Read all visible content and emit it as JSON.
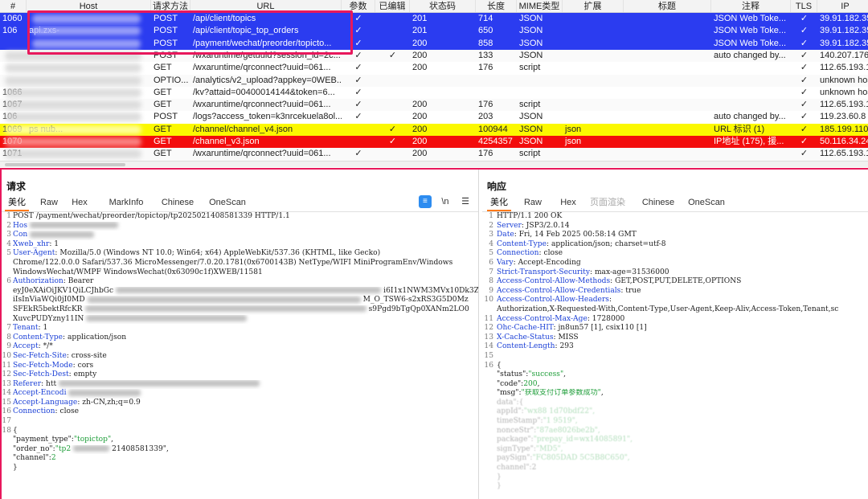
{
  "history": {
    "columns": [
      "#",
      "Host",
      "请求方法",
      "URL",
      "参数",
      "已编辑",
      "状态码",
      "长度",
      "MIME类型",
      "扩展",
      "标题",
      "注释",
      "TLS",
      "IP"
    ],
    "rows": [
      {
        "num": "1060",
        "host": "",
        "method": "POST",
        "url": "/api/client/topics",
        "params": "✓",
        "edited": "",
        "status": "201",
        "length": "714",
        "mime": "JSON",
        "ext": "",
        "title": "",
        "comment": "JSON Web Toke...",
        "tls": "✓",
        "ip": "39.91.182.35",
        "style": "blue"
      },
      {
        "num": "106",
        "host": "api.zxs-",
        "method": "POST",
        "url": "/api/client/topic_top_orders",
        "params": "✓",
        "edited": "",
        "status": "201",
        "length": "650",
        "mime": "JSON",
        "ext": "",
        "title": "",
        "comment": "JSON Web Toke...",
        "tls": "✓",
        "ip": "39.91.182.35",
        "style": "blue"
      },
      {
        "num": "",
        "host": "",
        "method": "POST",
        "url": "/payment/wechat/preorder/topicto...",
        "params": "✓",
        "edited": "",
        "status": "200",
        "length": "858",
        "mime": "JSON",
        "ext": "",
        "title": "",
        "comment": "JSON Web Toke...",
        "tls": "✓",
        "ip": "39.91.182.35",
        "style": "blue"
      },
      {
        "num": "",
        "host": "",
        "method": "POST",
        "url": "/wxaruntime/getuuid?session_id=2c...",
        "params": "✓",
        "edited": "✓",
        "status": "200",
        "length": "133",
        "mime": "JSON",
        "ext": "",
        "title": "",
        "comment": "auto changed by...",
        "tls": "✓",
        "ip": "140.207.176.2",
        "style": "white"
      },
      {
        "num": "",
        "host": "",
        "method": "GET",
        "url": "/wxaruntime/qrconnect?uuid=061...",
        "params": "✓",
        "edited": "",
        "status": "200",
        "length": "176",
        "mime": "script",
        "ext": "",
        "title": "",
        "comment": "",
        "tls": "✓",
        "ip": "112.65.193.15",
        "style": "white"
      },
      {
        "num": "",
        "host": "",
        "method": "OPTIO...",
        "url": "/analytics/v2_upload?appkey=0WEB...",
        "params": "✓",
        "edited": "",
        "status": "",
        "length": "",
        "mime": "",
        "ext": "",
        "title": "",
        "comment": "",
        "tls": "✓",
        "ip": "unknown hos",
        "style": "white"
      },
      {
        "num": "1066",
        "host": "",
        "method": "GET",
        "url": "/kv?attaid=00400014144&token=6...",
        "params": "✓",
        "edited": "",
        "status": "",
        "length": "",
        "mime": "",
        "ext": "",
        "title": "",
        "comment": "",
        "tls": "✓",
        "ip": "unknown hos",
        "style": "white"
      },
      {
        "num": "1067",
        "host": "",
        "method": "GET",
        "url": "/wxaruntime/qrconnect?uuid=061...",
        "params": "✓",
        "edited": "",
        "status": "200",
        "length": "176",
        "mime": "script",
        "ext": "",
        "title": "",
        "comment": "",
        "tls": "✓",
        "ip": "112.65.193.15",
        "style": "white"
      },
      {
        "num": "106",
        "host": "",
        "method": "POST",
        "url": "/logs?access_token=k3nrcekuela8ol...",
        "params": "✓",
        "edited": "",
        "status": "200",
        "length": "203",
        "mime": "JSON",
        "ext": "",
        "title": "",
        "comment": "auto changed by...",
        "tls": "✓",
        "ip": "119.23.60.8",
        "style": "white"
      },
      {
        "num": "1069",
        "host": "ps  nub...",
        "method": "GET",
        "url": "/channel/channel_v4.json",
        "params": "",
        "edited": "✓",
        "status": "200",
        "length": "100944",
        "mime": "JSON",
        "ext": "json",
        "title": "",
        "comment": "URL 标识 (1)",
        "tls": "✓",
        "ip": "185.199.110.1",
        "style": "yellow"
      },
      {
        "num": "1070",
        "host": "",
        "method": "GET",
        "url": "/channel_v3.json",
        "params": "",
        "edited": "✓",
        "status": "200",
        "length": "4254357",
        "mime": "JSON",
        "ext": "json",
        "title": "",
        "comment": "IP地址 (175), 援...",
        "tls": "✓",
        "ip": "50.116.34.24",
        "style": "red"
      },
      {
        "num": "1071",
        "host": "",
        "method": "GET",
        "url": "/wxaruntime/qrconnect?uuid=061...",
        "params": "✓",
        "edited": "",
        "status": "200",
        "length": "176",
        "mime": "script",
        "ext": "",
        "title": "",
        "comment": "",
        "tls": "✓",
        "ip": "112.65.193.15",
        "style": "white"
      }
    ]
  },
  "request": {
    "title": "请求",
    "tabs": [
      "美化",
      "Raw",
      "Hex",
      "MarkInfo",
      "Chinese",
      "OneScan"
    ],
    "icons": [
      "wrap-icon",
      "newline-icon",
      "menu-icon"
    ],
    "lines": [
      {
        "n": "1",
        "segs": [
          {
            "c": "hv",
            "t": "POST /payment/wechat/preorder/topictop/tp2025021408581339 HTTP/1.1"
          }
        ]
      },
      {
        "n": "2",
        "segs": [
          {
            "c": "hk",
            "t": "Hos"
          }
        ],
        "blur": 110
      },
      {
        "n": "3",
        "segs": [
          {
            "c": "hk",
            "t": "Con"
          }
        ],
        "blur": 80
      },
      {
        "n": "4",
        "segs": [
          {
            "c": "hk",
            "t": "Xweb_xhr"
          },
          {
            "c": "hv",
            "t": ": 1"
          }
        ]
      },
      {
        "n": "5",
        "segs": [
          {
            "c": "hk",
            "t": "User-Agent"
          },
          {
            "c": "hv",
            "t": ": Mozilla/5.0 (Windows NT 10.0; Win64; x64) AppleWebKit/537.36 (KHTML, like Gecko)"
          }
        ]
      },
      {
        "n": "",
        "segs": [
          {
            "c": "hv",
            "t": "Chrome/122.0.0.0 Safari/537.36 MicroMessenger/7.0.20.1781(0x6700143B) NetType/WIFI MiniProgramEnv/Windows"
          }
        ]
      },
      {
        "n": "",
        "segs": [
          {
            "c": "hv",
            "t": "WindowsWechat/WMPF WindowsWechat(0x63090c1f)XWEB/11581"
          }
        ]
      },
      {
        "n": "6",
        "segs": [
          {
            "c": "hk",
            "t": "Authorization"
          },
          {
            "c": "hv",
            "t": ": Bearer"
          }
        ]
      },
      {
        "n": "",
        "segs": [
          {
            "c": "hv",
            "t": "eyJ0eXAiOiJKV1QiLCJhbGc"
          }
        ],
        "blur": 330,
        "tail": "i6I1x1NWM3MVx10Dk3Z1x1NTkyNix1NWI2N"
      },
      {
        "n": "",
        "segs": [
          {
            "c": "hv",
            "t": "iIsInViaWQi0jI0MD"
          }
        ],
        "blur": 340,
        "tail": "M_O_TSW6-s2xRS3G5D0Mz"
      },
      {
        "n": "",
        "segs": [
          {
            "c": "hv",
            "t": "SFEkR5bektRfcKR"
          }
        ],
        "blur": 350,
        "tail": "s9Pgd9bTgQp0XANm2LO0"
      },
      {
        "n": "",
        "segs": [
          {
            "c": "hv",
            "t": "XuvcPUDYzny11IN"
          }
        ],
        "blur": 200
      },
      {
        "n": "7",
        "segs": [
          {
            "c": "hk",
            "t": "Tenant"
          },
          {
            "c": "hv",
            "t": ": 1"
          }
        ]
      },
      {
        "n": "8",
        "segs": [
          {
            "c": "hk",
            "t": "Content-Type"
          },
          {
            "c": "hv",
            "t": ": application/json"
          }
        ]
      },
      {
        "n": "9",
        "segs": [
          {
            "c": "hk",
            "t": "Accept"
          },
          {
            "c": "hv",
            "t": ": */*"
          }
        ]
      },
      {
        "n": "10",
        "segs": [
          {
            "c": "hk",
            "t": "Sec-Fetch-Site"
          },
          {
            "c": "hv",
            "t": ": cross-site"
          }
        ]
      },
      {
        "n": "11",
        "segs": [
          {
            "c": "hk",
            "t": "Sec-Fetch-Mode"
          },
          {
            "c": "hv",
            "t": ": cors"
          }
        ]
      },
      {
        "n": "12",
        "segs": [
          {
            "c": "hk",
            "t": "Sec-Fetch-Dest"
          },
          {
            "c": "hv",
            "t": ": empty"
          }
        ]
      },
      {
        "n": "13",
        "segs": [
          {
            "c": "hk",
            "t": "Referer"
          },
          {
            "c": "hv",
            "t": ": htt"
          }
        ],
        "blur": 250
      },
      {
        "n": "14",
        "segs": [
          {
            "c": "hk",
            "t": "Accept-Encodi"
          }
        ],
        "blur": 90
      },
      {
        "n": "15",
        "segs": [
          {
            "c": "hk",
            "t": "Accept-Language"
          },
          {
            "c": "hv",
            "t": ": zh-CN,zh;q=0.9"
          }
        ]
      },
      {
        "n": "16",
        "segs": [
          {
            "c": "hk",
            "t": "Connection"
          },
          {
            "c": "hv",
            "t": ": close"
          }
        ]
      },
      {
        "n": "17",
        "segs": []
      },
      {
        "n": "18",
        "segs": [
          {
            "c": "jbr",
            "t": "{"
          }
        ]
      },
      {
        "n": "",
        "segs": [
          {
            "c": "jk",
            "t": "  \"payment_type\":"
          },
          {
            "c": "js",
            "t": "\"topictop\""
          },
          {
            "c": "jbr",
            "t": ","
          }
        ]
      },
      {
        "n": "",
        "segs": [
          {
            "c": "jk",
            "t": "  \"order_no\":"
          },
          {
            "c": "js",
            "t": "\"tp2"
          }
        ],
        "blur": 45,
        "tail": "21408581339\","
      },
      {
        "n": "",
        "segs": [
          {
            "c": "jk",
            "t": "  \"channel\":"
          },
          {
            "c": "jn",
            "t": "2"
          }
        ]
      },
      {
        "n": "",
        "segs": [
          {
            "c": "jbr",
            "t": "}"
          }
        ]
      }
    ]
  },
  "response": {
    "title": "响应",
    "tabs": [
      "美化",
      "Raw",
      "Hex",
      "页面渲染",
      "Chinese",
      "OneScan"
    ],
    "lines": [
      {
        "n": "1",
        "segs": [
          {
            "c": "hv",
            "t": "HTTP/1.1 200 OK"
          }
        ]
      },
      {
        "n": "2",
        "segs": [
          {
            "c": "hk",
            "t": "Server"
          },
          {
            "c": "hv",
            "t": ": JSP3/2.0.14"
          }
        ]
      },
      {
        "n": "3",
        "segs": [
          {
            "c": "hk",
            "t": "Date"
          },
          {
            "c": "hv",
            "t": ": Fri, 14 Feb 2025 00:58:14 GMT"
          }
        ]
      },
      {
        "n": "4",
        "segs": [
          {
            "c": "hk",
            "t": "Content-Type"
          },
          {
            "c": "hv",
            "t": ": application/json; charset=utf-8"
          }
        ]
      },
      {
        "n": "5",
        "segs": [
          {
            "c": "hk",
            "t": "Connection"
          },
          {
            "c": "hv",
            "t": ": close"
          }
        ]
      },
      {
        "n": "6",
        "segs": [
          {
            "c": "hk",
            "t": "Vary"
          },
          {
            "c": "hv",
            "t": ": Accept-Encoding"
          }
        ]
      },
      {
        "n": "7",
        "segs": [
          {
            "c": "hk",
            "t": "Strict-Transport-Security"
          },
          {
            "c": "hv",
            "t": ": max-age=31536000"
          }
        ]
      },
      {
        "n": "8",
        "segs": [
          {
            "c": "hk",
            "t": "Access-Control-Allow-Methods"
          },
          {
            "c": "hv",
            "t": ": GET,POST,PUT,DELETE,OPTIONS"
          }
        ]
      },
      {
        "n": "9",
        "segs": [
          {
            "c": "hk",
            "t": "Access-Control-Allow-Credentials"
          },
          {
            "c": "hv",
            "t": ": true"
          }
        ]
      },
      {
        "n": "10",
        "segs": [
          {
            "c": "hk",
            "t": "Access-Control-Allow-Headers"
          },
          {
            "c": "hv",
            "t": ":"
          }
        ]
      },
      {
        "n": "",
        "segs": [
          {
            "c": "hv",
            "t": "Authorization,X-Requested-With,Content-Type,User-Agent,Keep-Aliv,Access-Token,Tenant,sc"
          }
        ]
      },
      {
        "n": "11",
        "segs": [
          {
            "c": "hk",
            "t": "Access-Control-Max-Age"
          },
          {
            "c": "hv",
            "t": ": 1728000"
          }
        ]
      },
      {
        "n": "12",
        "segs": [
          {
            "c": "hk",
            "t": "Ohc-Cache-HIT"
          },
          {
            "c": "hv",
            "t": ": jn8un57 [1], csix110 [1]"
          }
        ]
      },
      {
        "n": "13",
        "segs": [
          {
            "c": "hk",
            "t": "X-Cache-Status"
          },
          {
            "c": "hv",
            "t": ": MISS"
          }
        ]
      },
      {
        "n": "14",
        "segs": [
          {
            "c": "hk",
            "t": "Content-Length"
          },
          {
            "c": "hv",
            "t": ": 293"
          }
        ]
      },
      {
        "n": "15",
        "segs": []
      },
      {
        "n": "16",
        "segs": [
          {
            "c": "jbr",
            "t": "{"
          }
        ]
      },
      {
        "n": "",
        "segs": [
          {
            "c": "jk",
            "t": "  \"status\":"
          },
          {
            "c": "js",
            "t": "\"success\""
          },
          {
            "c": "jbr",
            "t": ","
          }
        ]
      },
      {
        "n": "",
        "segs": [
          {
            "c": "jk",
            "t": "  \"code\":"
          },
          {
            "c": "jn",
            "t": "200"
          },
          {
            "c": "jbr",
            "t": ","
          }
        ]
      },
      {
        "n": "",
        "segs": [
          {
            "c": "jk",
            "t": "  \"msg\":"
          },
          {
            "c": "js",
            "t": "\"获取支付订单参数成功\""
          },
          {
            "c": "jbr",
            "t": ","
          }
        ]
      },
      {
        "n": "",
        "faded": true,
        "segs": [
          {
            "c": "jk",
            "t": "    data\":{"
          }
        ]
      },
      {
        "n": "",
        "faded": true,
        "segs": [
          {
            "c": "jk",
            "t": "      appId\":"
          },
          {
            "c": "js",
            "t": "\"wx88      1d70bdf22\","
          }
        ]
      },
      {
        "n": "",
        "faded": true,
        "segs": [
          {
            "c": "jk",
            "t": "      timeStamp\":"
          },
          {
            "c": "js",
            "t": "\"1   9519\","
          }
        ]
      },
      {
        "n": "",
        "faded": true,
        "segs": [
          {
            "c": "jk",
            "t": "      nonceStr\":"
          },
          {
            "c": "js",
            "t": "\"87ae8026be2b\","
          }
        ]
      },
      {
        "n": "",
        "faded": true,
        "segs": [
          {
            "c": "jk",
            "t": "      package\":"
          },
          {
            "c": "js",
            "t": "\"prepay_id=wx14085891\","
          }
        ]
      },
      {
        "n": "",
        "faded": true,
        "segs": [
          {
            "c": "jk",
            "t": "      signType\":"
          },
          {
            "c": "js",
            "t": "\"MD5\","
          }
        ]
      },
      {
        "n": "",
        "faded": true,
        "segs": [
          {
            "c": "jk",
            "t": "      paySign\":"
          },
          {
            "c": "js",
            "t": "\"FC805DAD    5C5B8C650\","
          }
        ]
      },
      {
        "n": "",
        "faded": true,
        "segs": [
          {
            "c": "jk",
            "t": "      channel\":2"
          }
        ]
      },
      {
        "n": "",
        "faded": true,
        "segs": [
          {
            "c": "jbr",
            "t": "    }"
          }
        ]
      },
      {
        "n": "",
        "faded": true,
        "segs": [
          {
            "c": "jbr",
            "t": "  }"
          }
        ]
      }
    ]
  },
  "colors": {
    "selected_row": "#2b3cf0",
    "yellow_row": "#fbf800",
    "red_row": "#f30d0d",
    "highlight_box": "#e8185c",
    "tab_underline": "#ff7a1a",
    "header_key": "#1a3fd6",
    "json_string": "#1f9e3a"
  }
}
